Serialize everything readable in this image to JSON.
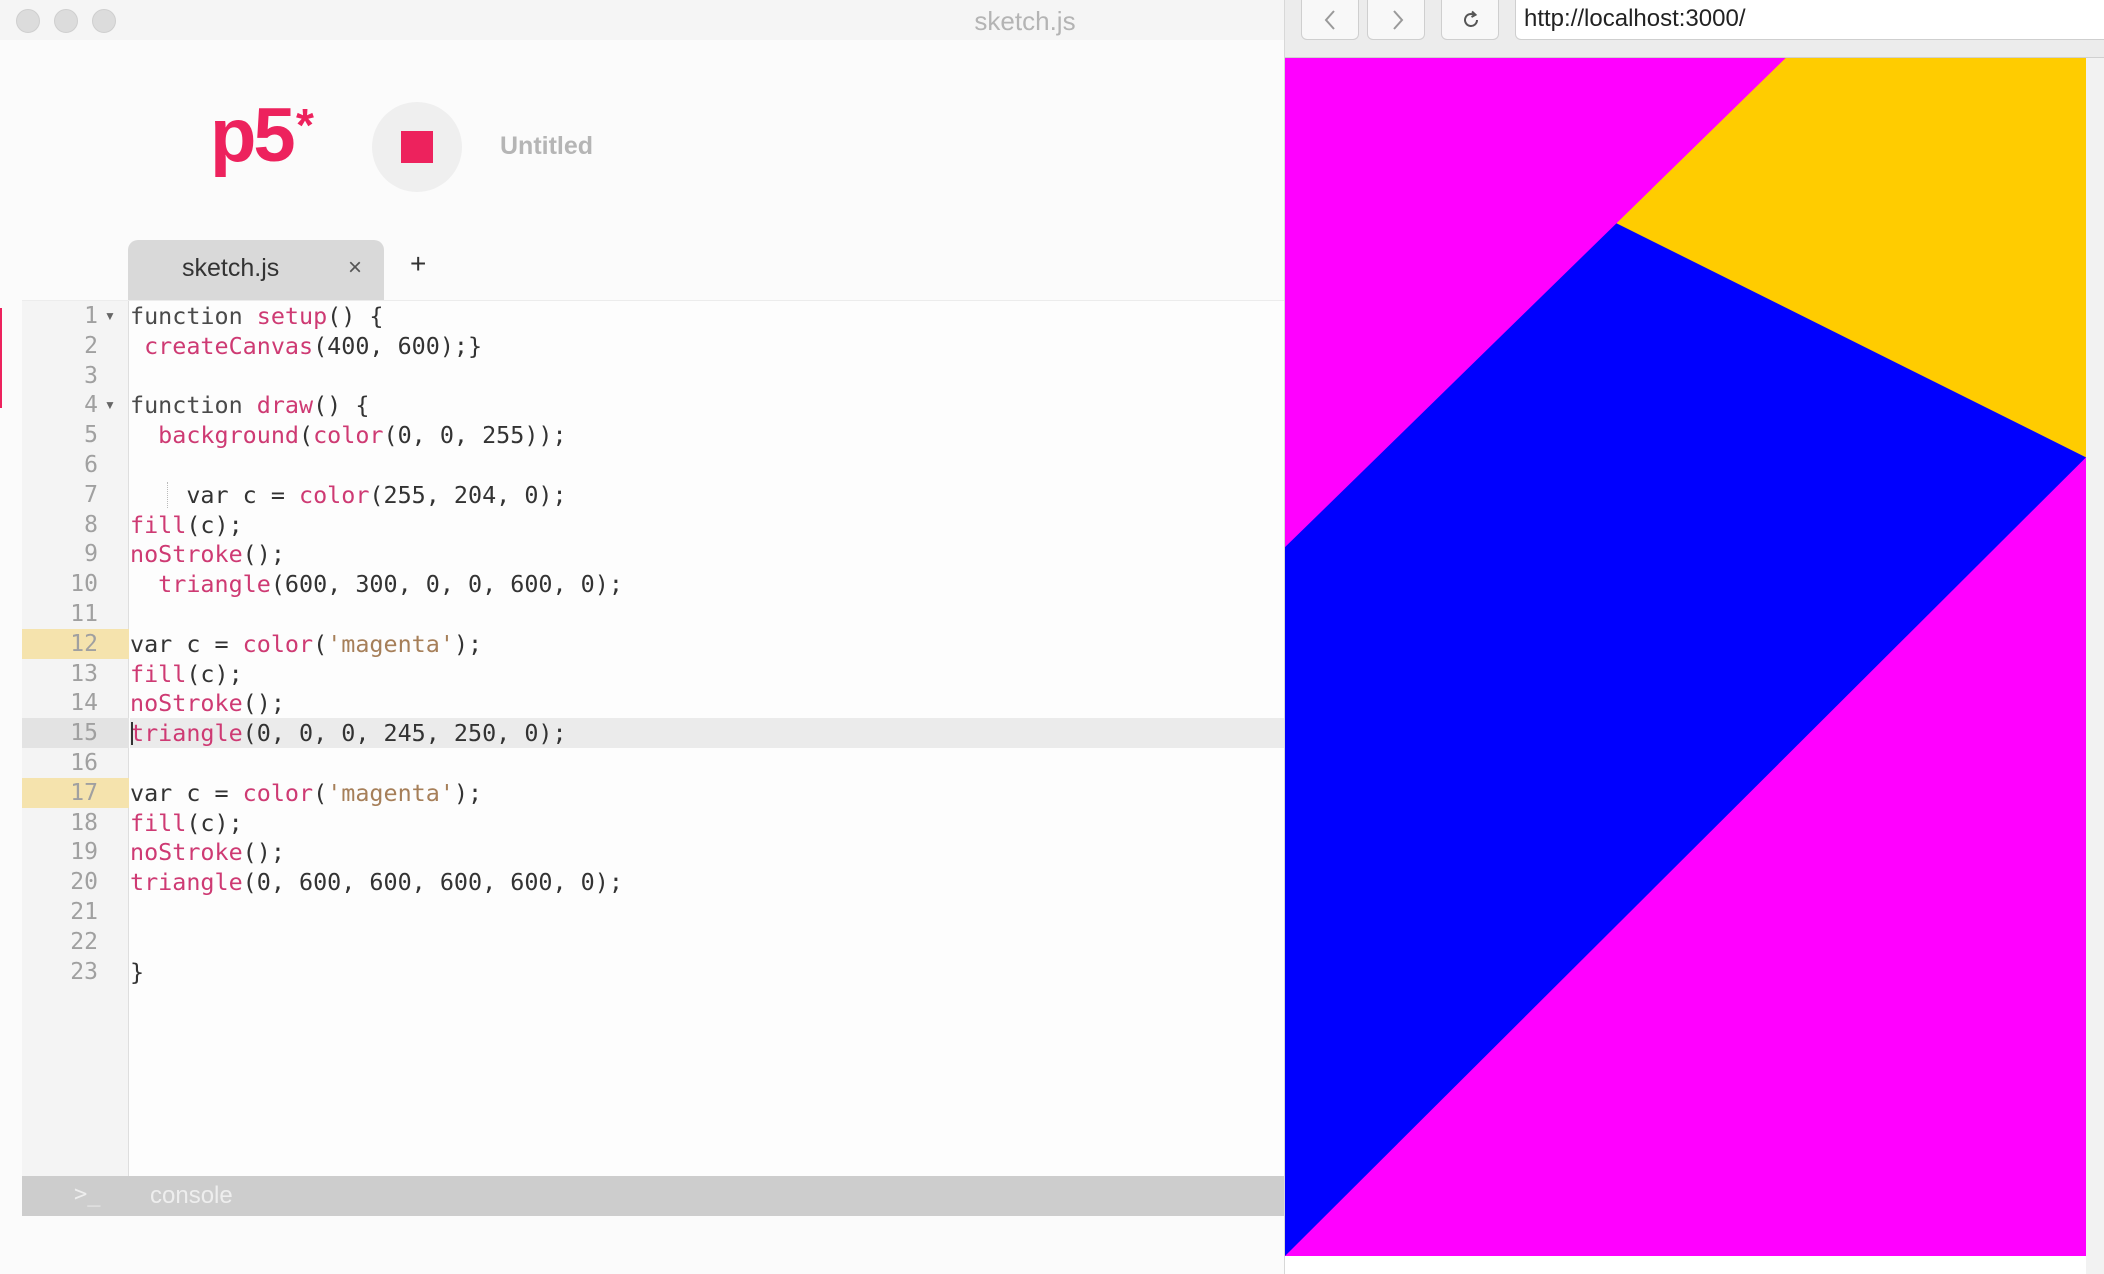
{
  "editor": {
    "window_title": "sketch.js",
    "logo": "p5",
    "logo_star": "*",
    "project_name": "Untitled",
    "tabs": [
      {
        "label": "sketch.js",
        "close": "×"
      }
    ],
    "add_tab": "+",
    "console": {
      "prompt": ">_",
      "label": "console"
    },
    "colors": {
      "accent": "#ed225d",
      "warning_line": "#f5e3ad",
      "active_line": "#ebebeb"
    },
    "code_lines": [
      {
        "num": "1",
        "fold": true,
        "tokens": [
          [
            "function ",
            "kw"
          ],
          [
            "setup",
            "fn"
          ],
          [
            "() {",
            ""
          ]
        ]
      },
      {
        "num": "2",
        "tokens": [
          [
            " ",
            ""
          ],
          [
            "createCanvas",
            "fn"
          ],
          [
            "(400, 600);}",
            ""
          ]
        ]
      },
      {
        "num": "3",
        "tokens": []
      },
      {
        "num": "4",
        "fold": true,
        "tokens": [
          [
            "function ",
            "kw"
          ],
          [
            "draw",
            "fn"
          ],
          [
            "() {",
            ""
          ]
        ]
      },
      {
        "num": "5",
        "tokens": [
          [
            "  ",
            ""
          ],
          [
            "background",
            "fn"
          ],
          [
            "(",
            ""
          ],
          [
            "color",
            "fn"
          ],
          [
            "(0, 0, 255));",
            ""
          ]
        ]
      },
      {
        "num": "6",
        "tokens": []
      },
      {
        "num": "7",
        "guide": true,
        "tokens": [
          [
            "    var c = ",
            ""
          ],
          [
            "color",
            "fn"
          ],
          [
            "(255, 204, 0);",
            ""
          ]
        ]
      },
      {
        "num": "8",
        "tokens": [
          [
            "fill",
            "fn"
          ],
          [
            "(c);",
            ""
          ]
        ]
      },
      {
        "num": "9",
        "tokens": [
          [
            "noStroke",
            "fn"
          ],
          [
            "();",
            ""
          ]
        ]
      },
      {
        "num": "10",
        "tokens": [
          [
            "  ",
            ""
          ],
          [
            "triangle",
            "fn"
          ],
          [
            "(600, 300, 0, 0, 600, 0);",
            ""
          ]
        ]
      },
      {
        "num": "11",
        "tokens": []
      },
      {
        "num": "12",
        "warn": true,
        "tokens": [
          [
            "var c = ",
            ""
          ],
          [
            "color",
            "fn"
          ],
          [
            "(",
            ""
          ],
          [
            "'magenta'",
            "str"
          ],
          [
            ");",
            ""
          ]
        ]
      },
      {
        "num": "13",
        "tokens": [
          [
            "fill",
            "fn"
          ],
          [
            "(c);",
            ""
          ]
        ]
      },
      {
        "num": "14",
        "tokens": [
          [
            "noStroke",
            "fn"
          ],
          [
            "();",
            ""
          ]
        ]
      },
      {
        "num": "15",
        "active": true,
        "tokens": [
          [
            "triangle",
            "fn"
          ],
          [
            "(0, 0, 0, 245, 250, 0);",
            ""
          ]
        ]
      },
      {
        "num": "16",
        "tokens": []
      },
      {
        "num": "17",
        "warn": true,
        "tokens": [
          [
            "var c = ",
            ""
          ],
          [
            "color",
            "fn"
          ],
          [
            "(",
            ""
          ],
          [
            "'magenta'",
            "str"
          ],
          [
            ");",
            ""
          ]
        ]
      },
      {
        "num": "18",
        "tokens": [
          [
            "fill",
            "fn"
          ],
          [
            "(c);",
            ""
          ]
        ]
      },
      {
        "num": "19",
        "tokens": [
          [
            "noStroke",
            "fn"
          ],
          [
            "();",
            ""
          ]
        ]
      },
      {
        "num": "20",
        "tokens": [
          [
            "triangle",
            "fn"
          ],
          [
            "(0, 600, 600, 600, 600, 0);",
            ""
          ]
        ]
      },
      {
        "num": "21",
        "tokens": []
      },
      {
        "num": "22",
        "tokens": []
      },
      {
        "num": "23",
        "tokens": [
          [
            "}",
            ""
          ]
        ]
      }
    ],
    "token_colors": {
      "kw": "#4a4a4a",
      "fn": "#ce3a73",
      "str": "#a67f59",
      "plain": "#333333"
    }
  },
  "browser": {
    "back_icon": "chevron-left-icon",
    "forward_icon": "chevron-right-icon",
    "reload_icon": "reload-icon",
    "url": "http://localhost:3000/",
    "sketch": {
      "canvas": {
        "width": 400,
        "height": 600
      },
      "background": "#0000ff",
      "triangles": [
        {
          "points": [
            600,
            300,
            0,
            0,
            600,
            0
          ],
          "fill": "#ffcc00"
        },
        {
          "points": [
            0,
            0,
            0,
            245,
            250,
            0
          ],
          "fill": "#ff00ff"
        },
        {
          "points": [
            0,
            600,
            600,
            600,
            600,
            0
          ],
          "fill": "#ff00ff"
        }
      ]
    }
  }
}
